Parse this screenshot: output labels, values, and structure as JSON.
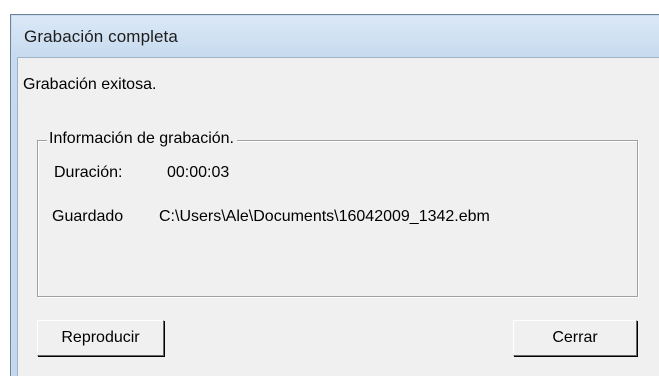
{
  "window": {
    "title": "Grabación completa"
  },
  "message": "Grabación exitosa.",
  "info_group": {
    "legend": "Información de grabación.",
    "duration_label": "Duración:",
    "duration_value": "00:00:03",
    "saved_label": "Guardado",
    "saved_value": "C:\\Users\\Ale\\Documents\\16042009_1342.ebm"
  },
  "buttons": {
    "play_label": "Reproducir",
    "close_label": "Cerrar"
  },
  "colors": {
    "titlebar": "#c7dbef",
    "client_background": "#f0f0f0",
    "frame_border": "#6f8399"
  }
}
